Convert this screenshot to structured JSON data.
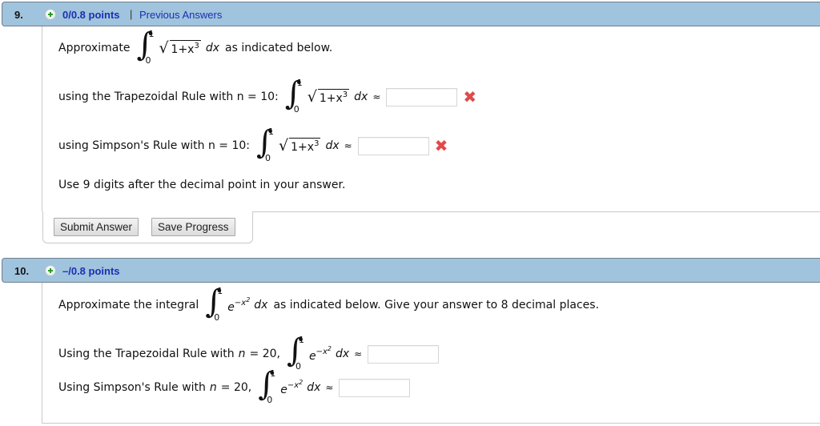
{
  "questions": [
    {
      "number": "9.",
      "points": "0/0.8 points",
      "separator": "|",
      "previous_answers_link": "Previous Answers",
      "intro": {
        "prefix": "Approximate",
        "integral": {
          "lower": "0",
          "upper": "1",
          "integrand_radicand": "1+x",
          "exponent": "3",
          "dx": "dx"
        },
        "suffix": "as indicated below."
      },
      "parts": [
        {
          "label": "using the Trapezoidal Rule with n = 10:",
          "value": "",
          "status": "incorrect",
          "status_glyph": "✖"
        },
        {
          "label": "using Simpson's Rule with n = 10:",
          "value": "",
          "status": "incorrect",
          "status_glyph": "✖"
        }
      ],
      "note": "Use 9 digits after the decimal point in your answer.",
      "buttons": {
        "submit": "Submit Answer",
        "save": "Save Progress"
      }
    },
    {
      "number": "10.",
      "points": "–/0.8 points",
      "intro": {
        "prefix": "Approximate the integral",
        "integral": {
          "lower": "0",
          "upper": "1",
          "base": "e",
          "exponent": "−x",
          "exponent_power": "2",
          "dx": "dx"
        },
        "suffix": "as indicated below. Give your answer to 8 decimal places."
      },
      "parts": [
        {
          "label_prefix": "Using the Trapezoidal Rule with",
          "var": "n",
          "label_suffix": "= 20,",
          "value": ""
        },
        {
          "label_prefix": "Using Simpson's Rule with",
          "var": "n",
          "label_suffix": "= 20,",
          "value": ""
        }
      ]
    }
  ],
  "symbols": {
    "approx": "≈",
    "integral": "∫",
    "sqrt": "√"
  },
  "colors": {
    "header_bg": "#a0c3de",
    "link": "#1c2fb0",
    "error": "#e04a4a"
  }
}
